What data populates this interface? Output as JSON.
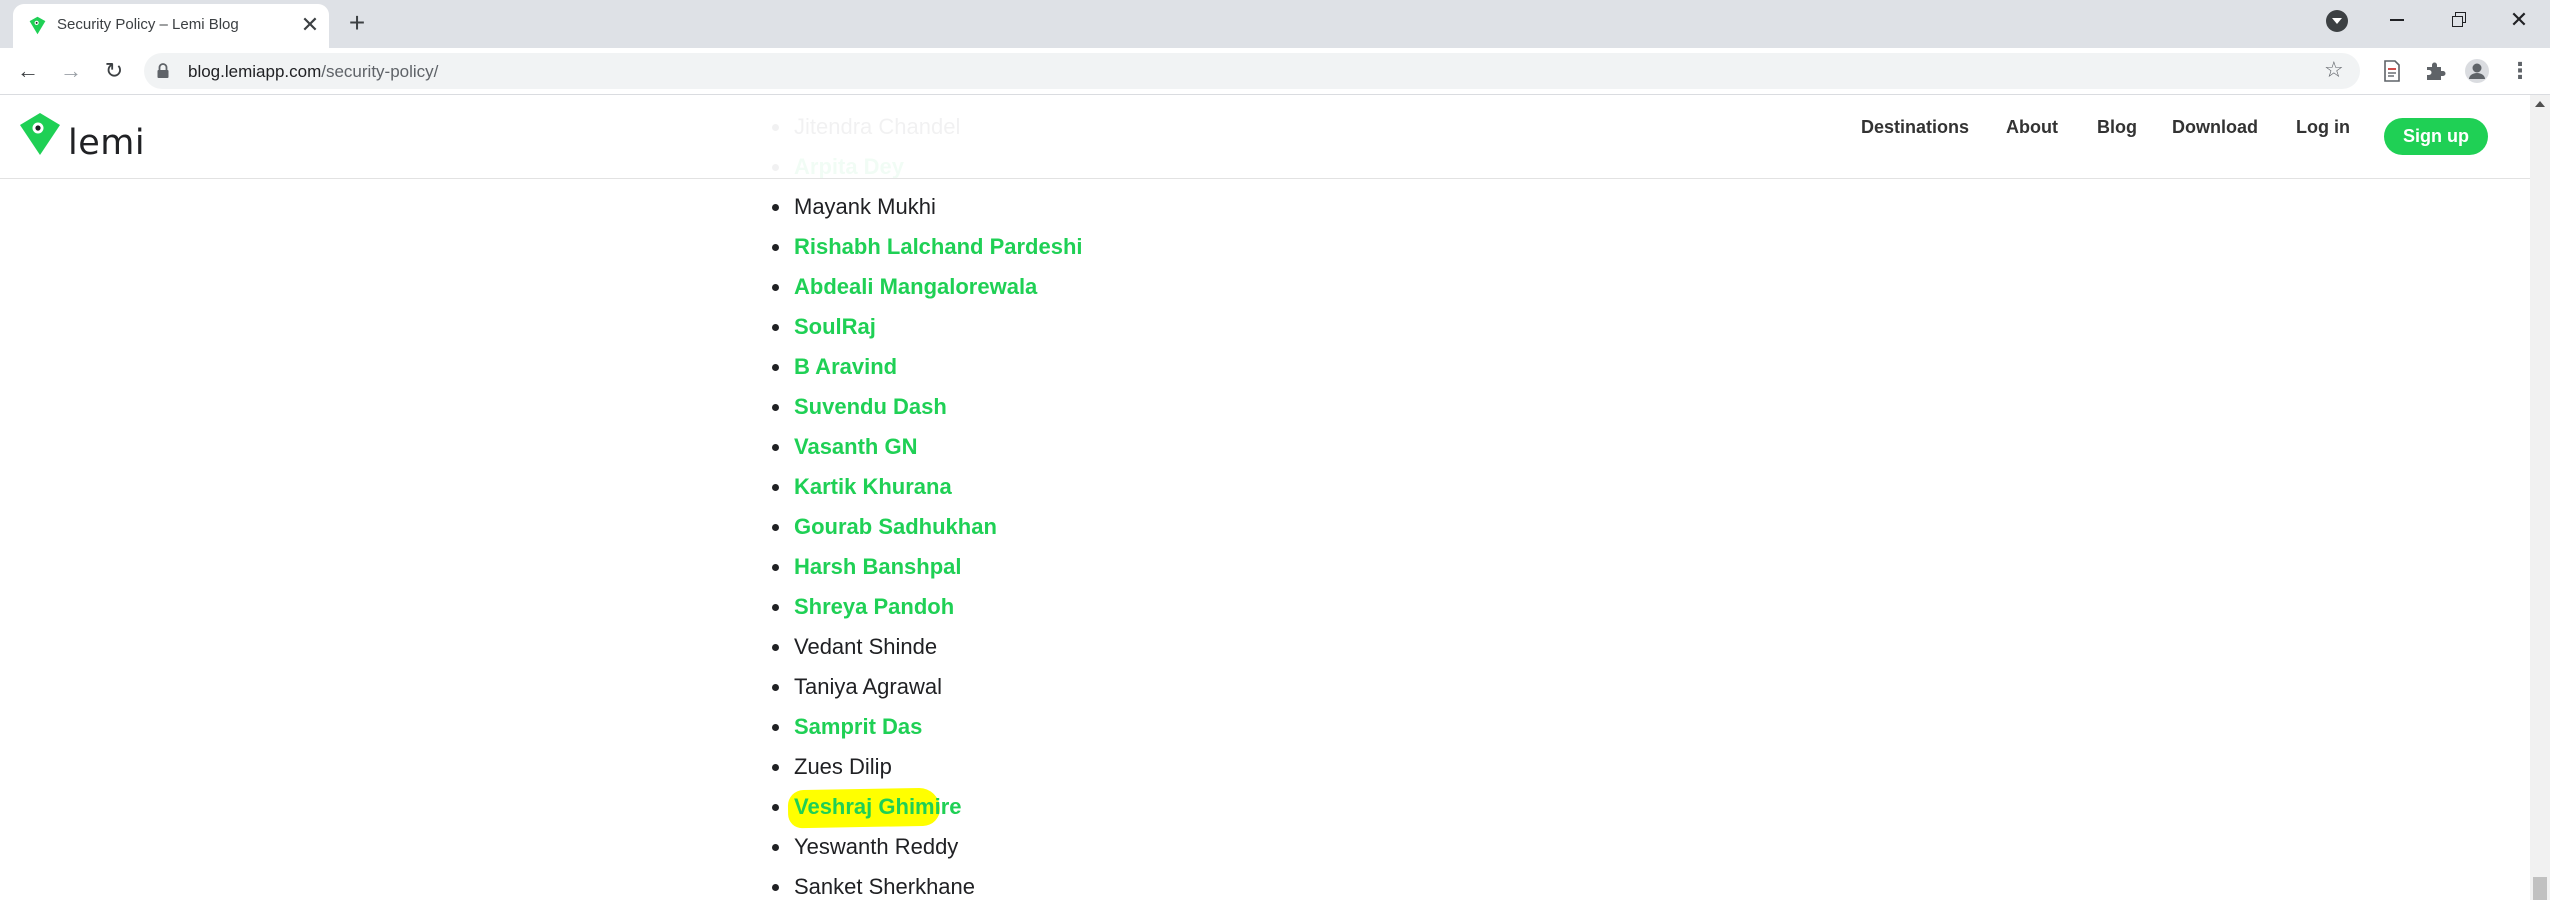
{
  "browser": {
    "tab_title": "Security Policy – Lemi Blog",
    "new_tab_symbol": "+",
    "tab_close_symbol": "✕",
    "url_host": "blog.lemiapp.com",
    "url_path": "/security-policy/",
    "icons": {
      "back": "←",
      "forward": "→",
      "reload": "↻",
      "star": "☆",
      "menu": "⋮",
      "close": "✕"
    }
  },
  "site": {
    "logo_text": "lemi",
    "brand_color": "#1fd055",
    "nav": {
      "destinations": "Destinations",
      "about": "About",
      "blog": "Blog",
      "download": "Download",
      "login": "Log in",
      "signup": "Sign up"
    }
  },
  "contributors": [
    {
      "name": "Jitendra Chandel",
      "link": false
    },
    {
      "name": "Arpita Dey",
      "link": true
    },
    {
      "name": "Mayank Mukhi",
      "link": false
    },
    {
      "name": "Rishabh Lalchand Pardeshi",
      "link": true
    },
    {
      "name": "Abdeali Mangalorewala",
      "link": true
    },
    {
      "name": "SoulRaj",
      "link": true
    },
    {
      "name": "B Aravind",
      "link": true
    },
    {
      "name": "Suvendu Dash",
      "link": true
    },
    {
      "name": "Vasanth GN",
      "link": true
    },
    {
      "name": "Kartik Khurana",
      "link": true
    },
    {
      "name": "Gourab Sadhukhan",
      "link": true
    },
    {
      "name": "Harsh Banshpal",
      "link": true
    },
    {
      "name": "Shreya Pandoh",
      "link": true
    },
    {
      "name": "Vedant Shinde",
      "link": false
    },
    {
      "name": "Taniya Agrawal",
      "link": false
    },
    {
      "name": "Samprit Das",
      "link": true
    },
    {
      "name": "Zues Dilip",
      "link": false
    },
    {
      "name": "Veshraj Ghimire",
      "link": true,
      "highlighted": true
    },
    {
      "name": "Yeswanth Reddy",
      "link": false
    },
    {
      "name": "Sanket Sherkhane",
      "link": false
    }
  ]
}
